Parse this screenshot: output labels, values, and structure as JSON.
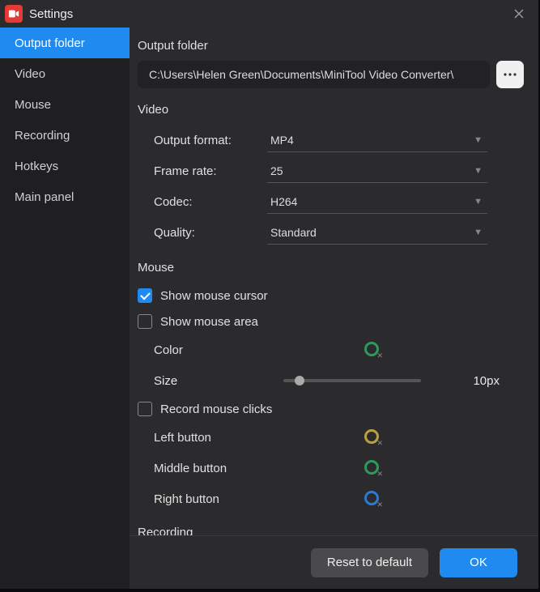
{
  "title": "Settings",
  "sidebar": {
    "items": [
      {
        "label": "Output folder",
        "active": true
      },
      {
        "label": "Video"
      },
      {
        "label": "Mouse"
      },
      {
        "label": "Recording"
      },
      {
        "label": "Hotkeys"
      },
      {
        "label": "Main panel"
      }
    ]
  },
  "output_folder": {
    "title": "Output folder",
    "path": "C:\\Users\\Helen Green\\Documents\\MiniTool Video Converter\\"
  },
  "video": {
    "title": "Video",
    "format_label": "Output format:",
    "format_value": "MP4",
    "framerate_label": "Frame rate:",
    "framerate_value": "25",
    "codec_label": "Codec:",
    "codec_value": "H264",
    "quality_label": "Quality:",
    "quality_value": "Standard"
  },
  "mouse": {
    "title": "Mouse",
    "show_cursor": "Show mouse cursor",
    "show_area": "Show mouse area",
    "color_label": "Color",
    "size_label": "Size",
    "size_value": "10px",
    "record_clicks": "Record mouse clicks",
    "left": "Left button",
    "middle": "Middle button",
    "right": "Right button",
    "colors": {
      "area": "#2e9a5a",
      "left": "#b9a23a",
      "middle": "#2e9a5a",
      "right": "#2a7bd6"
    }
  },
  "recording": {
    "title": "Recording"
  },
  "footer": {
    "reset": "Reset to default",
    "ok": "OK"
  }
}
